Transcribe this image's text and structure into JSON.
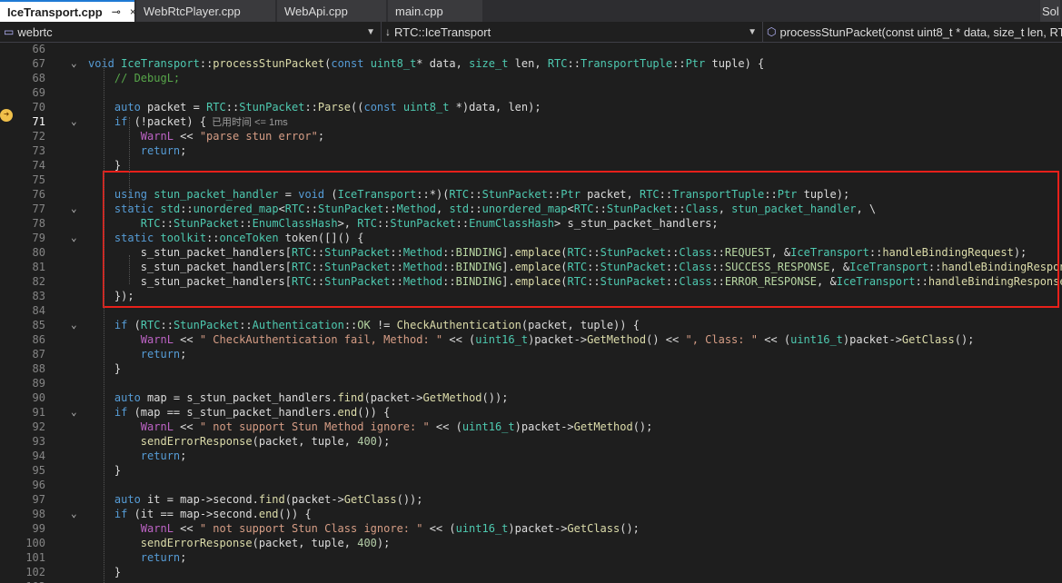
{
  "tabs": [
    {
      "label": "IceTransport.cpp",
      "pin": "⊸",
      "close": "×",
      "active": true
    },
    {
      "label": "WebRtcPlayer.cpp",
      "active": false
    },
    {
      "label": "WebApi.cpp",
      "active": false
    },
    {
      "label": "main.cpp",
      "active": false
    }
  ],
  "tab_overflow": "Sol",
  "nav": {
    "project": "webrtc",
    "scope": "RTC::IceTransport",
    "member": "processStunPacket(const uint8_t * data, size_t len, RTC"
  },
  "colors": {
    "highlight_box": "#e8201a",
    "keyword": "#569cd6",
    "type": "#4ec9b0",
    "function": "#dcdcaa",
    "string": "#d69d85",
    "comment": "#57a64a",
    "number": "#b5cea8"
  },
  "exec_hint": "已用时间 <= 1ms",
  "lines": [
    {
      "n": "66",
      "code": ""
    },
    {
      "n": "67",
      "code": "void IceTransport::processStunPacket(const uint8_t* data, size_t len, RTC::TransportTuple::Ptr tuple) {"
    },
    {
      "n": "68",
      "code": "    // DebugL;"
    },
    {
      "n": "69",
      "code": ""
    },
    {
      "n": "70",
      "code": "    auto packet = RTC::StunPacket::Parse((const uint8_t *)data, len);"
    },
    {
      "n": "71",
      "code": "    if (!packet) {"
    },
    {
      "n": "72",
      "code": "        WarnL << \"parse stun error\";"
    },
    {
      "n": "73",
      "code": "        return;"
    },
    {
      "n": "74",
      "code": "    }"
    },
    {
      "n": "75",
      "code": ""
    },
    {
      "n": "76",
      "code": "    using stun_packet_handler = void (IceTransport::*)(RTC::StunPacket::Ptr packet, RTC::TransportTuple::Ptr tuple);"
    },
    {
      "n": "77",
      "code": "    static std::unordered_map<RTC::StunPacket::Method, std::unordered_map<RTC::StunPacket::Class, stun_packet_handler, \\"
    },
    {
      "n": "78",
      "code": "        RTC::StunPacket::EnumClassHash>, RTC::StunPacket::EnumClassHash> s_stun_packet_handlers;"
    },
    {
      "n": "79",
      "code": "    static toolkit::onceToken token([]() {"
    },
    {
      "n": "80",
      "code": "        s_stun_packet_handlers[RTC::StunPacket::Method::BINDING].emplace(RTC::StunPacket::Class::REQUEST, &IceTransport::handleBindingRequest);"
    },
    {
      "n": "81",
      "code": "        s_stun_packet_handlers[RTC::StunPacket::Method::BINDING].emplace(RTC::StunPacket::Class::SUCCESS_RESPONSE, &IceTransport::handleBindingResponse);"
    },
    {
      "n": "82",
      "code": "        s_stun_packet_handlers[RTC::StunPacket::Method::BINDING].emplace(RTC::StunPacket::Class::ERROR_RESPONSE, &IceTransport::handleBindingResponse);"
    },
    {
      "n": "83",
      "code": "    });"
    },
    {
      "n": "84",
      "code": ""
    },
    {
      "n": "85",
      "code": "    if (RTC::StunPacket::Authentication::OK != CheckAuthentication(packet, tuple)) {"
    },
    {
      "n": "86",
      "code": "        WarnL << \" CheckAuthentication fail, Method: \" << (uint16_t)packet->GetMethod() << \", Class: \" << (uint16_t)packet->GetClass();"
    },
    {
      "n": "87",
      "code": "        return;"
    },
    {
      "n": "88",
      "code": "    }"
    },
    {
      "n": "89",
      "code": ""
    },
    {
      "n": "90",
      "code": "    auto map = s_stun_packet_handlers.find(packet->GetMethod());"
    },
    {
      "n": "91",
      "code": "    if (map == s_stun_packet_handlers.end()) {"
    },
    {
      "n": "92",
      "code": "        WarnL << \" not support Stun Method ignore: \" << (uint16_t)packet->GetMethod();"
    },
    {
      "n": "93",
      "code": "        sendErrorResponse(packet, tuple, 400);"
    },
    {
      "n": "94",
      "code": "        return;"
    },
    {
      "n": "95",
      "code": "    }"
    },
    {
      "n": "96",
      "code": ""
    },
    {
      "n": "97",
      "code": "    auto it = map->second.find(packet->GetClass());"
    },
    {
      "n": "98",
      "code": "    if (it == map->second.end()) {"
    },
    {
      "n": "99",
      "code": "        WarnL << \" not support Stun Class ignore: \" << (uint16_t)packet->GetClass();"
    },
    {
      "n": "100",
      "code": "        sendErrorResponse(packet, tuple, 400);"
    },
    {
      "n": "101",
      "code": "        return;"
    },
    {
      "n": "102",
      "code": "    }"
    },
    {
      "n": "103",
      "code": ""
    }
  ],
  "folds": [
    "67",
    "71",
    "77",
    "79",
    "85",
    "91",
    "98"
  ],
  "current_line": "71"
}
